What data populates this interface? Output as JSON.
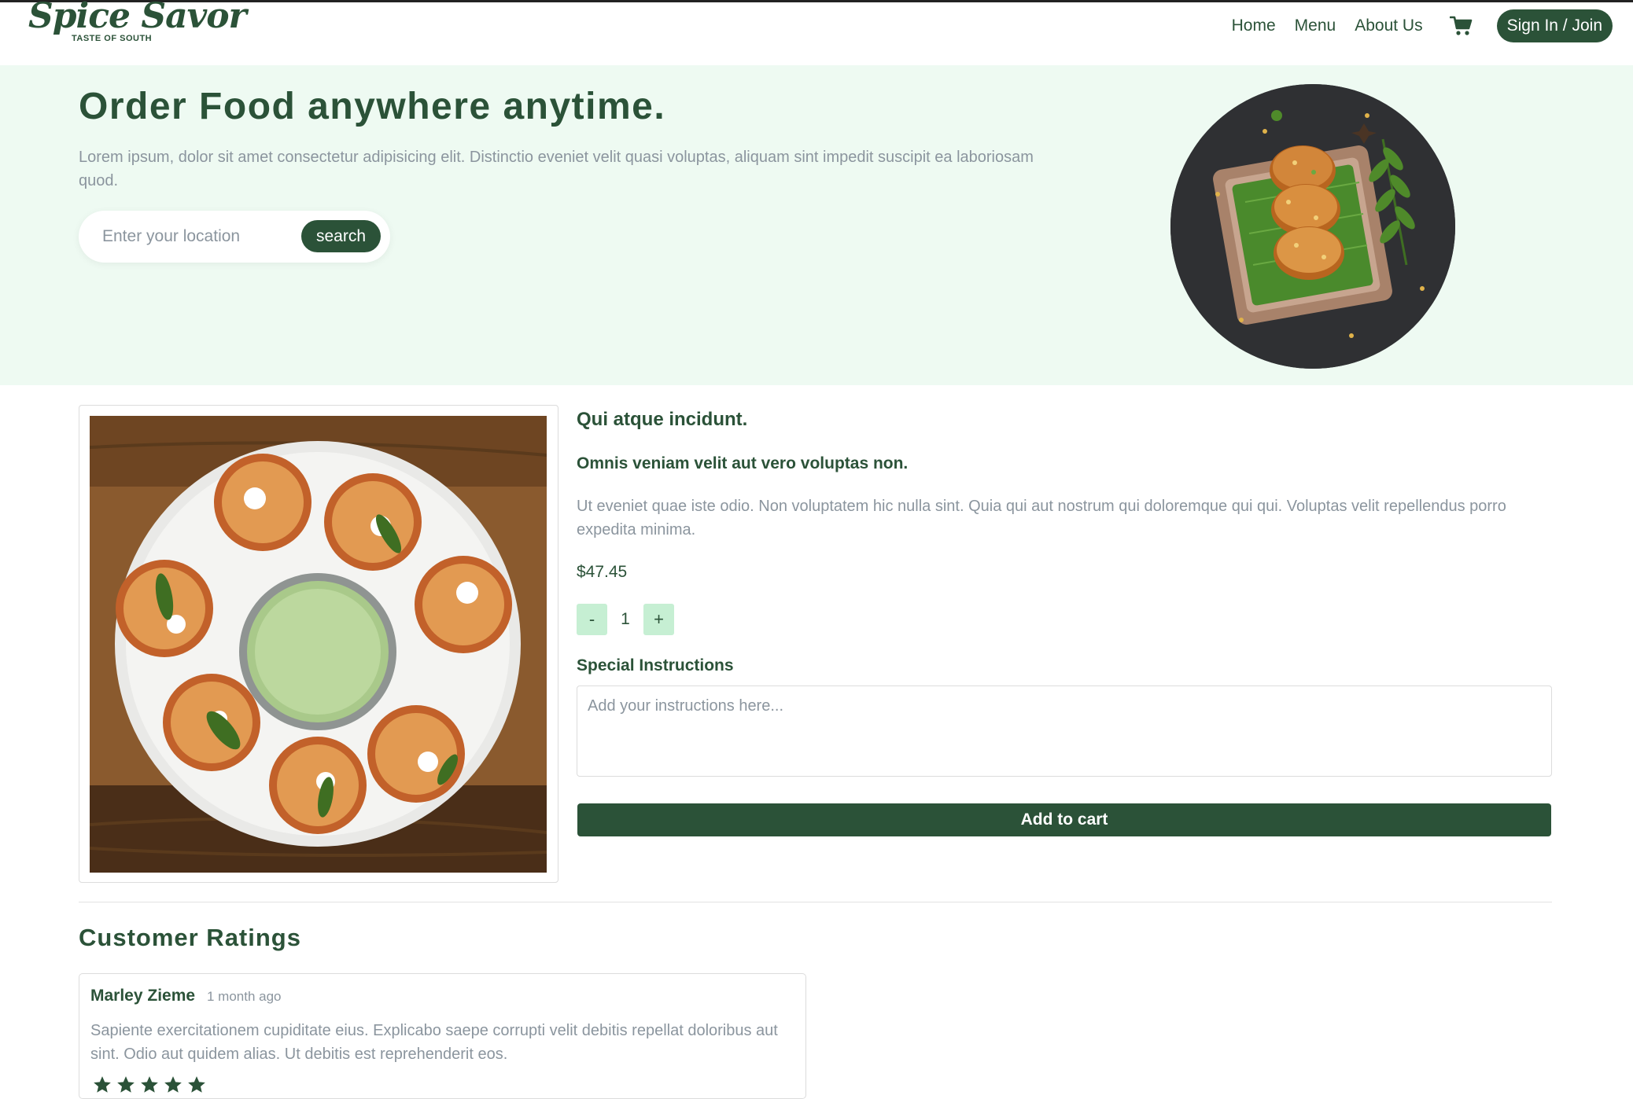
{
  "nav": {
    "logo_text": "Spice Savor",
    "logo_tagline": "TASTE OF SOUTH",
    "links": [
      "Home",
      "Menu",
      "About Us"
    ],
    "cart_icon": "cart-icon",
    "signin_label": "Sign In / Join"
  },
  "hero": {
    "title": "Order Food anywhere anytime.",
    "text": "Lorem ipsum, dolor sit amet consectetur adipisicing elit. Distinctio eveniet velit quasi voluptas, aliquam sint impedit suscipit ea laboriosam quod.",
    "search_placeholder": "Enter your location",
    "search_label": "search"
  },
  "product": {
    "title": "Qui atque incidunt.",
    "subtitle": "Omnis veniam velit aut vero voluptas non.",
    "description": "Ut eveniet quae iste odio. Non voluptatem hic nulla sint. Quia qui aut nostrum qui doloremque qui qui. Voluptas velit repellendus porro expedita minima.",
    "price": "$47.45",
    "qty_minus": "-",
    "quantity": "1",
    "qty_plus": "+",
    "instructions_label": "Special Instructions",
    "instructions_placeholder": "Add your instructions here...",
    "add_to_cart_label": "Add to cart"
  },
  "ratings": {
    "title": "Customer Ratings",
    "reviews": [
      {
        "name": "Marley Zieme",
        "time": "1 month ago",
        "text": "Sapiente exercitationem cupiditate eius. Explicabo saepe corrupti velit debitis repellat doloribus aut sint. Odio aut quidem alias. Ut debitis est reprehenderit eos.",
        "stars": 5
      }
    ]
  },
  "colors": {
    "brand": "#2b5238",
    "hero_bg": "#eefaf2",
    "qty_bg": "#c6efd3",
    "muted_text": "#8b959e"
  }
}
